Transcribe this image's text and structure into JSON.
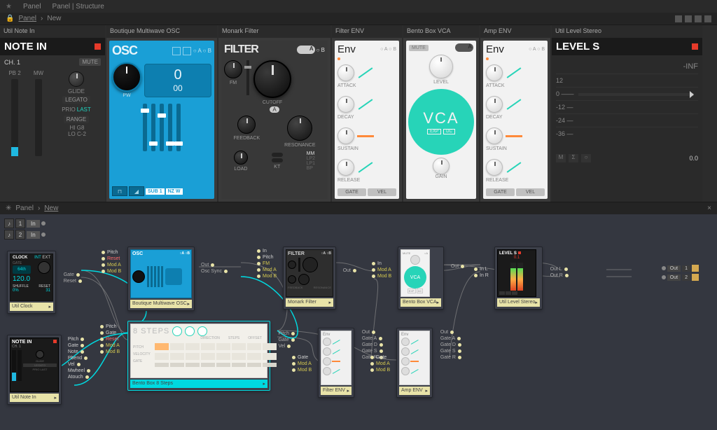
{
  "menu": {
    "item1": "Panel",
    "item2": "Panel | Structure",
    "star": "★"
  },
  "breadcrumb": {
    "level0": "Panel",
    "level1": "New",
    "sep": "›",
    "lockIcon": "🔒"
  },
  "rightIcons": [
    "▯",
    "≡",
    "□",
    "□"
  ],
  "noteIn": {
    "title": "Util Note In",
    "header": "NOTE IN",
    "channel": "CH. 1",
    "mute": "MUTE",
    "pb": "PB 2",
    "mw": "MW",
    "glide": "GLIDE",
    "legato": "LEGATO",
    "prio": "PRIO",
    "prioVal": "LAST",
    "range": "RANGE",
    "hi": "HI",
    "hiVal": "G8",
    "lo": "LO",
    "loVal": "C-2"
  },
  "osc": {
    "title": "Boutique Multiwave OSC",
    "header": "OSC",
    "ab": "○ A ○ B",
    "pw": "PW",
    "display1": "0",
    "display2": "00",
    "waveSquare": "⊓",
    "waveSaw": "◢",
    "sub1": "SUB 1",
    "nzw": "NZ W"
  },
  "filter": {
    "title": "Monark Filter",
    "header": "FILTER",
    "ab": "○ B",
    "fm": "FM",
    "cutoff": "CUTOFF",
    "aBtn": "A",
    "feedback": "FEEDBACK",
    "resonance": "RESONANCE",
    "load": "LOAD",
    "kt": "KT",
    "modes": {
      "mm": "MM",
      "lp2": "LP2",
      "lp1": "LP1",
      "bp": "BP"
    }
  },
  "filterEnv": {
    "title": "Filter ENV",
    "header": "Env",
    "ab": "○ A ○ B",
    "attack": "ATTACK",
    "decay": "DECAY",
    "sustain": "SUSTAIN",
    "release": "RELEASE",
    "gate": "GATE",
    "vel": "VEL"
  },
  "vca": {
    "title": "Bento Box VCA",
    "mute": "MUTE",
    "ab": "A",
    "level": "LEVEL",
    "text": "VCA",
    "exp": "EXP",
    "dc": "DC",
    "gain": "GAIN"
  },
  "ampEnv": {
    "title": "Amp ENV",
    "header": "Env",
    "ab": "○ A ○ B",
    "attack": "ATTACK",
    "decay": "DECAY",
    "sustain": "SUSTAIN",
    "release": "RELEASE",
    "gate": "GATE",
    "vel": "VEL"
  },
  "levels": {
    "title": "Util Level Stereo",
    "header": "LEVEL S",
    "inf": "-INF",
    "scale": {
      "p12": "12",
      "zero": "0 ——",
      "m12": "-12 —",
      "m24": "-24 —",
      "m36": "-36 —"
    },
    "m": "M",
    "s": "Σ",
    "x": "○",
    "val": "0.0"
  },
  "structure": {
    "breadcrumb": {
      "level0": "Panel",
      "level1": "New",
      "star": "✳"
    },
    "in1": "In",
    "in2": "In",
    "num1": "1",
    "num2": "2",
    "out": "Out",
    "outL": "Out L",
    "outR": "Out R",
    "blocks": {
      "clock": {
        "label": "Util Clock",
        "name": "CLOCK",
        "int": "INT",
        "ext": "EXT",
        "gate": "GATE",
        "rate": "64th",
        "bpm": "120.0",
        "shuffle": "SHUFFLE",
        "shufVal": "0%",
        "reset": "RESET",
        "resetVal": "31",
        "ports": {
          "gate": "Gate",
          "resetOut": "Reset"
        }
      },
      "noteIn": {
        "label": "Util Note In",
        "name": "NOTE IN",
        "ch": "CH. 1",
        "ports": {
          "pitch": "Pitch",
          "gate": "Gate",
          "note": "Note",
          "pbend": "Pbend",
          "vel": "Vel",
          "mwheel": "Mwheel",
          "atouch": "Atouch"
        }
      },
      "osc": {
        "label": "Boutique Multiwave OSC",
        "name": "OSC",
        "ports": {
          "pitch": "Pitch",
          "reset": "Reset",
          "modA": "Mod A",
          "modB": "Mod B",
          "out": "Out",
          "oscSync": "Osc Sync"
        }
      },
      "steps": {
        "label": "Bento Box 8 Steps",
        "title": "8 STEPS",
        "direction": "DIRECTION",
        "steps": "STEPS",
        "offset": "OFFSET",
        "pitch": "PITCH",
        "velocity": "VELOCITY",
        "gate": "GATE",
        "ports": {
          "pitch": "Pitch",
          "gate": "Gate",
          "reset": "Reset",
          "modA": "Mod A",
          "modB": "Mod B",
          "outPitch": "Pitch",
          "outGate": "Gate",
          "outVel": "Vel"
        }
      },
      "filter": {
        "label": "Monark Filter",
        "name": "FILTER",
        "ports": {
          "in": "In",
          "pitch": "Pitch",
          "fm": "FM",
          "modA": "Mod A",
          "modB": "Mod B",
          "out": "Out"
        }
      },
      "filterEnv": {
        "label": "Filter ENV",
        "name": "Env",
        "ports": {
          "gate": "Gate",
          "modA": "Mod A",
          "modB": "Mod B",
          "out": "Out",
          "gateA": "Gate A",
          "gateD": "Gate D",
          "gateS": "Gate S",
          "gateR": "Gate R"
        }
      },
      "vca": {
        "label": "Bento Box VCA",
        "name": "VCA",
        "ports": {
          "in": "In",
          "modA": "Mod A",
          "modB": "Mod B",
          "out": "Out"
        }
      },
      "ampEnv": {
        "label": "Amp ENV",
        "name": "Env",
        "ports": {
          "gate": "Gate",
          "modA": "Mod A",
          "modB": "Mod B",
          "out": "Out",
          "gateA": "Gate A",
          "gateD": "Gate D",
          "gateS": "Gate S",
          "gateR": "Gate R"
        }
      },
      "levelS": {
        "label": "Util Level Stereo",
        "name": "LEVEL S",
        "val": "0.1",
        "ports": {
          "inL": "In L",
          "inR": "In R",
          "outL": "Out L",
          "outR": "Out R"
        }
      }
    }
  }
}
